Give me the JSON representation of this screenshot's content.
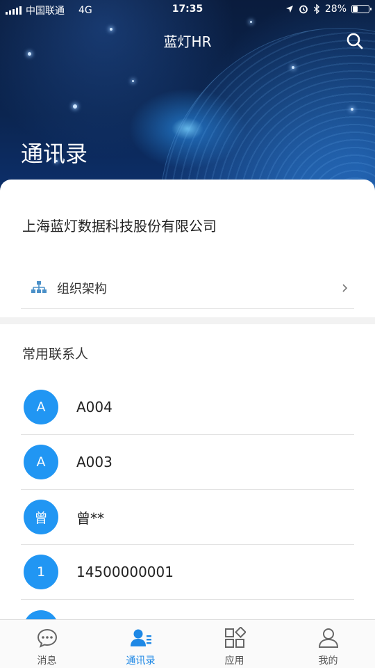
{
  "status_bar": {
    "carrier": "中国联通",
    "network": "4G",
    "time": "17:35",
    "battery": "28%",
    "battery_level": 0.28
  },
  "header": {
    "app_title": "蓝灯HR",
    "page_title": "通讯录"
  },
  "company": {
    "name": "上海蓝灯数据科技股份有限公司",
    "org_label": "组织架构"
  },
  "contacts": {
    "heading": "常用联系人",
    "items": [
      {
        "avatar": "A",
        "name": "A004"
      },
      {
        "avatar": "A",
        "name": "A003"
      },
      {
        "avatar": "曾",
        "name": "曾**"
      },
      {
        "avatar": "1",
        "name": "14500000001"
      },
      {
        "avatar": "",
        "name": ""
      }
    ]
  },
  "tabs": [
    {
      "label": "消息",
      "icon": "message-icon",
      "active": false
    },
    {
      "label": "通讯录",
      "icon": "contacts-icon",
      "active": true
    },
    {
      "label": "应用",
      "icon": "apps-icon",
      "active": false
    },
    {
      "label": "我的",
      "icon": "profile-icon",
      "active": false
    }
  ],
  "colors": {
    "accent": "#1e88e5",
    "avatar_bg": "#2196f3",
    "org_icon": "#4a90c8"
  }
}
